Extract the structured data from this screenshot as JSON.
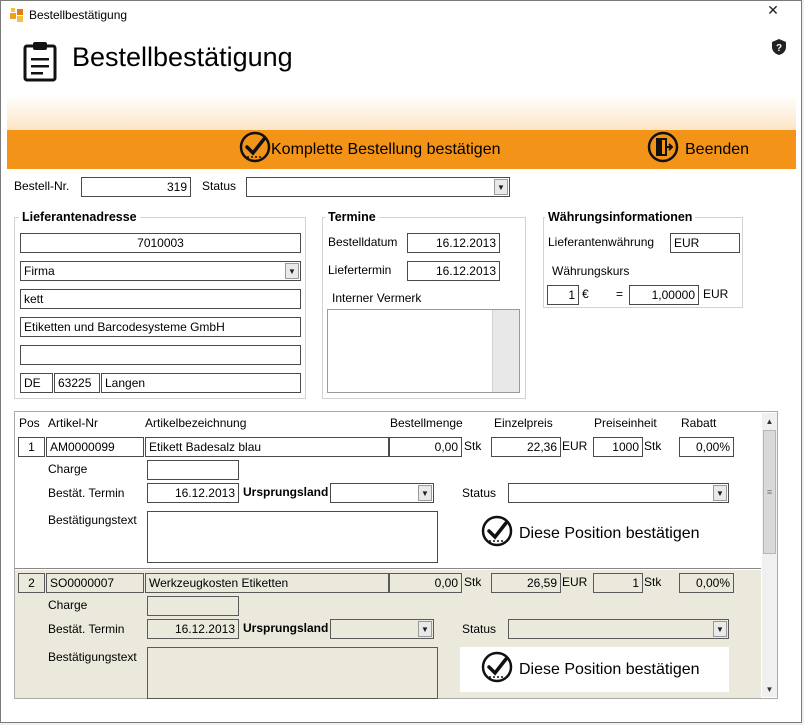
{
  "window": {
    "title": "Bestellbestätigung"
  },
  "header": {
    "title": "Bestellbestätigung"
  },
  "toolbar": {
    "confirm_all_label": "Komplette Bestellung bestätigen",
    "exit_label": "Beenden"
  },
  "order": {
    "nr_label": "Bestell-Nr.",
    "nr_value": "319",
    "status_label": "Status",
    "status_value": ""
  },
  "supplier": {
    "title": "Lieferantenadresse",
    "number": "7010003",
    "salutation": "Firma",
    "name1": "kett",
    "name2": "Etiketten und Barcodesysteme GmbH",
    "street": "",
    "country": "DE",
    "zip": "63225",
    "city": "Langen"
  },
  "dates": {
    "title": "Termine",
    "order_date_label": "Bestelldatum",
    "order_date": "16.12.2013",
    "delivery_label": "Liefertermin",
    "delivery_date": "16.12.2013",
    "note_label": "Interner Vermerk",
    "note": ""
  },
  "currency": {
    "title": "Währungsinformationen",
    "supplier_currency_label": "Lieferantenwährung",
    "supplier_currency": "EUR",
    "rate_label": "Währungskurs",
    "rate_left": "1",
    "euro_sign": "€",
    "equals": "=",
    "rate_right": "1,00000",
    "rate_currency": "EUR"
  },
  "columns": {
    "pos": "Pos",
    "article_nr": "Artikel-Nr",
    "description": "Artikelbezeichnung",
    "quantity": "Bestellmenge",
    "unit_price": "Einzelpreis",
    "price_unit": "Preiseinheit",
    "discount": "Rabatt"
  },
  "row_labels": {
    "charge": "Charge",
    "confirm_date": "Bestät. Termin",
    "origin": "Ursprungsland",
    "status": "Status",
    "confirm_text": "Bestätigungstext",
    "confirm_button": "Diese Position bestätigen"
  },
  "positions": [
    {
      "pos": "1",
      "article_nr": "AM0000099",
      "description": "Etikett Badesalz blau",
      "quantity": "0,00",
      "qty_unit": "Stk",
      "unit_price": "22,36",
      "currency": "EUR",
      "price_unit": "1000",
      "pu_unit": "Stk",
      "discount": "0,00%",
      "charge": "",
      "confirm_date": "16.12.2013",
      "origin": "",
      "status": "",
      "text": ""
    },
    {
      "pos": "2",
      "article_nr": "SO0000007",
      "description": "Werkzeugkosten Etiketten",
      "quantity": "0,00",
      "qty_unit": "Stk",
      "unit_price": "26,59",
      "currency": "EUR",
      "price_unit": "1",
      "pu_unit": "Stk",
      "discount": "0,00%",
      "charge": "",
      "confirm_date": "16.12.2013",
      "origin": "",
      "status": "",
      "text": ""
    }
  ],
  "colors": {
    "accent": "#f39317",
    "selected_row": "#ebe8dc"
  },
  "icons": {
    "app": "app-icon",
    "clipboard": "clipboard-icon",
    "help": "help-shield-icon",
    "check": "check-circle-icon",
    "exit": "exit-door-icon"
  }
}
